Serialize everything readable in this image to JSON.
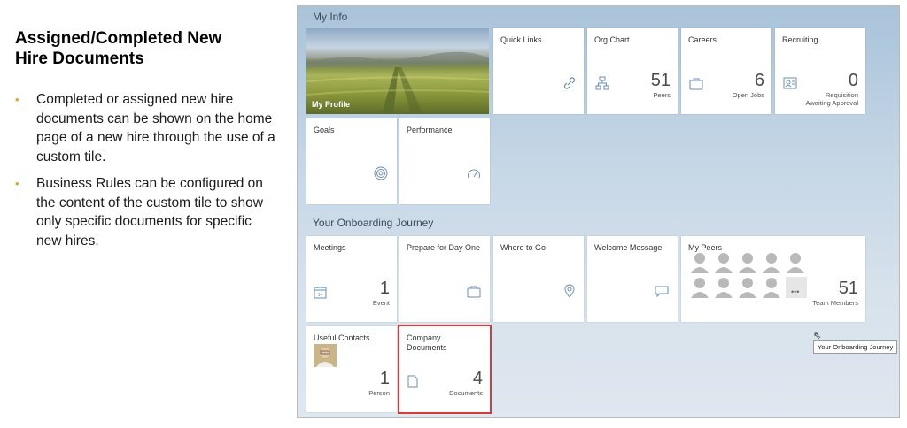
{
  "slide": {
    "title_line1": "Assigned/Completed New",
    "title_line2": "Hire Documents",
    "bullets": [
      "Completed or assigned new hire documents can be shown on the home page of a new hire through the use of a custom tile.",
      "Business Rules can be configured on the content of the custom tile to show only specific documents for specific new hires."
    ]
  },
  "my_info": {
    "section_title": "My Info",
    "profile_label": "My Profile",
    "tiles": {
      "quick_links": {
        "title": "Quick Links",
        "icon": "link-icon"
      },
      "org_chart": {
        "title": "Org Chart",
        "value": "51",
        "unit": "Peers",
        "icon": "org-chart-icon"
      },
      "careers": {
        "title": "Careers",
        "value": "6",
        "unit": "Open Jobs",
        "icon": "briefcase-icon"
      },
      "recruiting": {
        "title": "Recruiting",
        "value": "0",
        "unit_line1": "Requisition",
        "unit_line2": "Awaiting Approval",
        "icon": "recruiting-icon"
      },
      "goals": {
        "title": "Goals",
        "icon": "target-icon"
      },
      "performance": {
        "title": "Performance",
        "icon": "gauge-icon"
      }
    }
  },
  "onboarding": {
    "section_title": "Your Onboarding Journey",
    "tiles": {
      "meetings": {
        "title": "Meetings",
        "value": "1",
        "unit": "Event",
        "icon": "calendar-icon"
      },
      "prepare": {
        "title": "Prepare for Day One",
        "icon": "briefcase-icon"
      },
      "where_to_go": {
        "title": "Where to Go",
        "icon": "location-pin-icon"
      },
      "welcome": {
        "title": "Welcome Message",
        "icon": "message-icon"
      },
      "my_peers": {
        "title": "My Peers",
        "value": "51",
        "unit": "Team Members",
        "more": "•••"
      },
      "useful_contacts": {
        "title": "Useful Contacts",
        "value": "1",
        "unit": "Person"
      },
      "company_documents": {
        "title_line1": "Company",
        "title_line2": "Documents",
        "value": "4",
        "unit": "Documents",
        "icon": "document-icon"
      }
    },
    "tooltip": "Your Onboarding Journey"
  },
  "colors": {
    "highlight": "#d23c3c",
    "bullet": "#e8a317",
    "icon": "#6a8db5"
  }
}
